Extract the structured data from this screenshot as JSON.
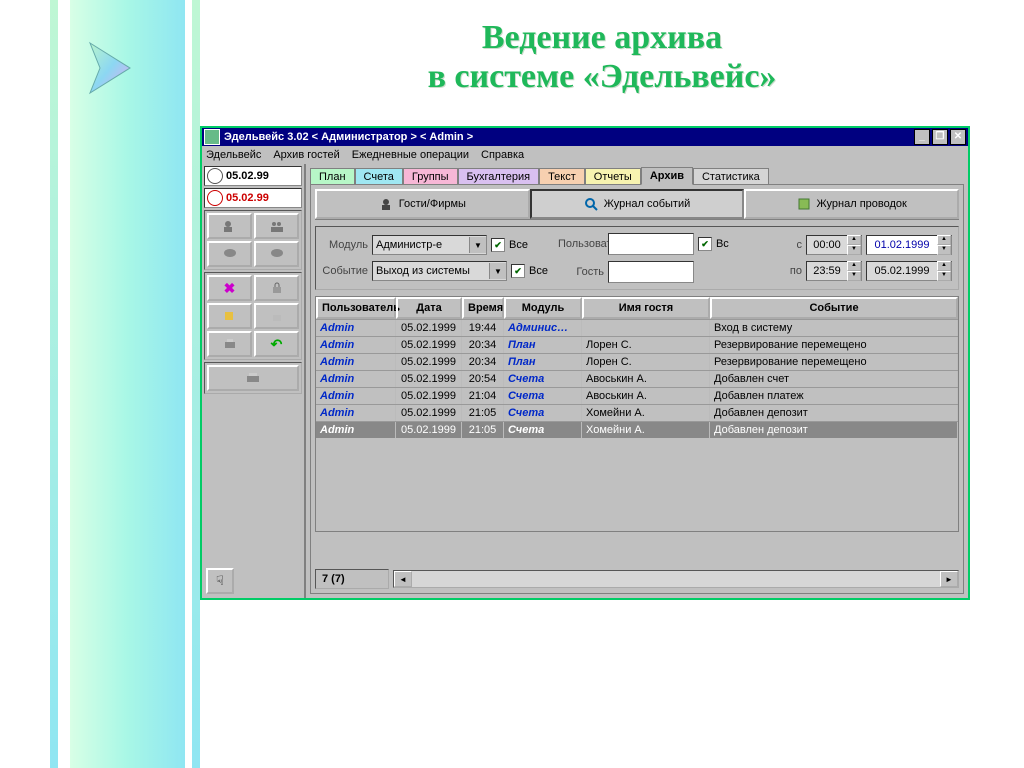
{
  "slide": {
    "heading_line1": "Ведение архива",
    "heading_line2": "в системе «Эдельвейс»"
  },
  "window": {
    "title": "Эдельвейс 3.02 < Администратор > < Admin >",
    "buttons": {
      "min": "_",
      "max": "❐",
      "close": "✕"
    }
  },
  "menu": [
    "Эдельвейс",
    "Архив гостей",
    "Ежедневные операции",
    "Справка"
  ],
  "dates": {
    "today": "05.02.99",
    "alt": "05.02.99"
  },
  "tabs": [
    {
      "label": "План",
      "cls": "c-green"
    },
    {
      "label": "Счета",
      "cls": "c-cyan"
    },
    {
      "label": "Группы",
      "cls": "c-pink"
    },
    {
      "label": "Бухгалтерия",
      "cls": "c-violet"
    },
    {
      "label": "Текст",
      "cls": "c-orange"
    },
    {
      "label": "Отчеты",
      "cls": "c-yellow"
    },
    {
      "label": "Архив",
      "cls": "c-grey",
      "active": true
    },
    {
      "label": "Статистика",
      "cls": "c-grey"
    }
  ],
  "subtabs": {
    "guests": "Гости/Фирмы",
    "events": "Журнал событий",
    "postings": "Журнал проводок"
  },
  "filters": {
    "module_lbl": "Модуль",
    "module_val": "Администр-е",
    "all": "Все",
    "event_lbl": "Событие",
    "event_val": "Выход из системы",
    "user_lbl": "Пользоват",
    "user_all": "Вс",
    "guest_lbl": "Гость",
    "from_lbl": "с",
    "from_time": "00:00",
    "from_date": "01.02.1999",
    "to_lbl": "по",
    "to_time": "23:59",
    "to_date": "05.02.1999"
  },
  "columns": {
    "user": "Пользователь",
    "date": "Дата",
    "time": "Время",
    "module": "Модуль",
    "guest": "Имя гостя",
    "event": "Событие"
  },
  "rows": [
    {
      "user": "Admin",
      "date": "05.02.1999",
      "time": "19:44",
      "module": "Администр-е",
      "guest": "",
      "event": "Вход в систему"
    },
    {
      "user": "Admin",
      "date": "05.02.1999",
      "time": "20:34",
      "module": "План",
      "guest": "Лорен С.",
      "event": "Резервирование перемещено"
    },
    {
      "user": "Admin",
      "date": "05.02.1999",
      "time": "20:34",
      "module": "План",
      "guest": "Лорен С.",
      "event": "Резервирование перемещено"
    },
    {
      "user": "Admin",
      "date": "05.02.1999",
      "time": "20:54",
      "module": "Счета",
      "guest": "Авоськин А.",
      "event": "Добавлен счет"
    },
    {
      "user": "Admin",
      "date": "05.02.1999",
      "time": "21:04",
      "module": "Счета",
      "guest": "Авоськин А.",
      "event": "Добавлен платеж"
    },
    {
      "user": "Admin",
      "date": "05.02.1999",
      "time": "21:05",
      "module": "Счета",
      "guest": "Хомейни А.",
      "event": "Добавлен депозит"
    },
    {
      "user": "Admin",
      "date": "05.02.1999",
      "time": "21:05",
      "module": "Счета",
      "guest": "Хомейни А.",
      "event": "Добавлен депозит",
      "selected": true
    }
  ],
  "status": {
    "count": "7 (7)"
  }
}
